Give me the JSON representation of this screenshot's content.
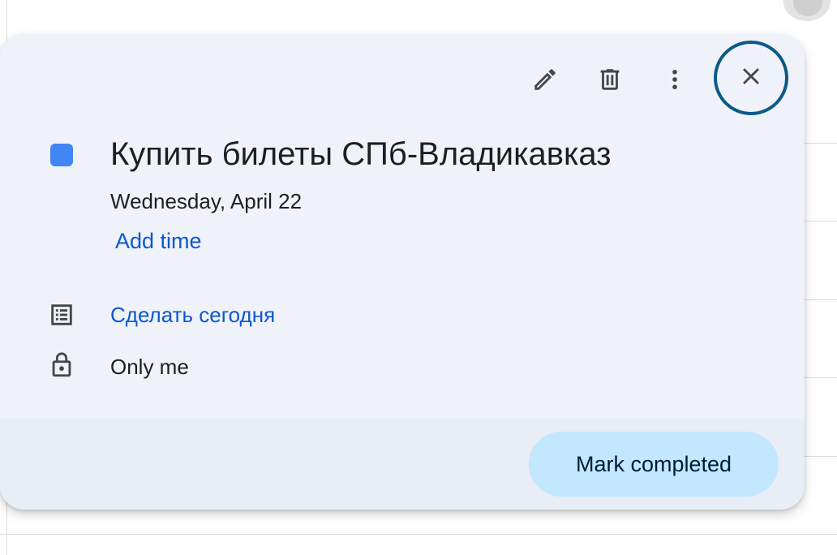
{
  "task": {
    "title": "Купить билеты СПб-Владикавказ",
    "date": "Wednesday, April 22",
    "add_time_label": "Add time",
    "color": "#4285f4",
    "list_name": "Сделать сегодня",
    "visibility": "Only me"
  },
  "toolbar": {
    "edit_icon": "pencil-icon",
    "delete_icon": "trash-icon",
    "more_icon": "more-vert-icon",
    "close_icon": "close-icon"
  },
  "footer": {
    "mark_completed_label": "Mark completed"
  },
  "colors": {
    "accent_link": "#0b57d0",
    "button_bg": "#c2e7ff",
    "popup_bg": "#eff2f9",
    "close_ring": "#0b5a86"
  }
}
